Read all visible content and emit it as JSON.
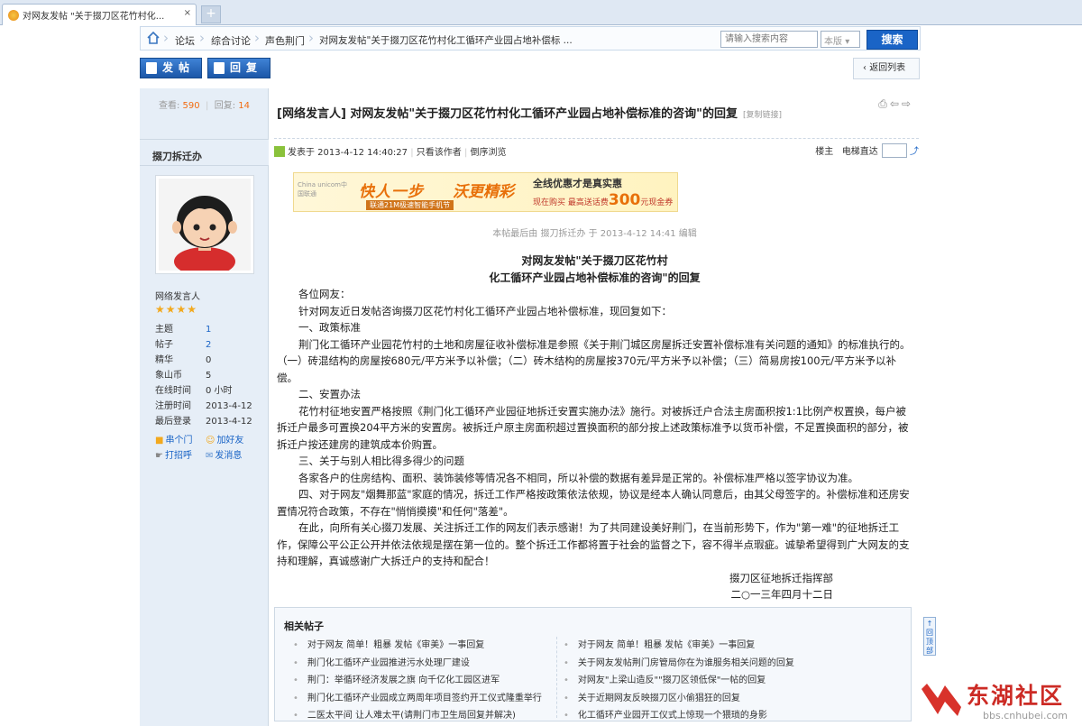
{
  "browser": {
    "tab_title": "对网友发帖 \"关于掇刀区花竹村化...",
    "close": "×",
    "new_tab": "+"
  },
  "breadcrumb": {
    "items": [
      "论坛",
      "综合讨论",
      "声色荆门",
      "对网友发帖\"关于掇刀区花竹村化工循环产业园占地补偿标 ..."
    ],
    "search_placeholder": "请输入搜索内容",
    "scope": "本版",
    "search_button": "搜索"
  },
  "toolbar": {
    "post_button": "发帖",
    "reply_button": "回复",
    "back_button": "返回列表"
  },
  "stats": {
    "views_label": "查看:",
    "views": "590",
    "replies_label": "回复:",
    "replies": "14"
  },
  "author": {
    "name": "掇刀拆迁办",
    "group": "网络发言人",
    "stars": "★★★★",
    "info": [
      {
        "k": "主题",
        "v": "1",
        "link": true
      },
      {
        "k": "帖子",
        "v": "2",
        "link": true
      },
      {
        "k": "精华",
        "v": "0",
        "link": false
      },
      {
        "k": "象山币",
        "v": "5",
        "link": false
      },
      {
        "k": "在线时间",
        "v": "0 小时",
        "link": false
      },
      {
        "k": "注册时间",
        "v": "2013-4-12",
        "link": false
      },
      {
        "k": "最后登录",
        "v": "2013-4-12",
        "link": false
      }
    ],
    "actions": [
      "串个门",
      "加好友",
      "打招呼",
      "发消息"
    ]
  },
  "post": {
    "title": "[网络发言人] 对网友发帖\"关于掇刀区花竹村化工循环产业园占地补偿标准的咨询\"的回复",
    "copy_link": "[复制链接]",
    "meta_time": "发表于 2013-4-12 14:40:27",
    "only_author": "只看该作者",
    "reverse": "倒序浏览",
    "floor": "楼主",
    "jump": "电梯直达",
    "edited": "本帖最后由 掇刀拆迁办 于 2013-4-12 14:41 编辑",
    "ad": {
      "logo": "China unicom中国联通",
      "slogan1": "快人一步",
      "slogan2": "沃更精彩",
      "promo": "全线优惠才是真实惠",
      "price_prefix": "现在购买 最高送话费",
      "price": "300",
      "price_suffix": "元现金券",
      "sub": "联通21M极速智能手机节"
    },
    "heading1": "对网友发帖\"关于掇刀区花竹村",
    "heading2": "化工循环产业园占地补偿标准的咨询\"的回复",
    "paragraphs": [
      "各位网友：",
      "针对网友近日发帖咨询掇刀区花竹村化工循环产业园占地补偿标准，现回复如下：",
      "一、政策标准",
      "荆门化工循环产业园花竹村的土地和房屋征收补偿标准是参照《关于荆门城区房屋拆迁安置补偿标准有关问题的通知》的标准执行的。（一）砖混结构的房屋按680元/平方米予以补偿；（二）砖木结构的房屋按370元/平方米予以补偿；（三）简易房按100元/平方米予以补偿。",
      "二、安置办法",
      "花竹村征地安置严格按照《荆门化工循环产业园征地拆迁安置实施办法》施行。对被拆迁户合法主房面积按1:1比例产权置换，每户被拆迁户最多可置换204平方米的安置房。被拆迁户原主房面积超过置换面积的部分按上述政策标准予以货币补偿，不足置换面积的部分，被拆迁户按还建房的建筑成本价购置。",
      "三、关于与别人相比得多得少的问题",
      "各家各户的住房结构、面积、装饰装修等情况各不相同，所以补偿的数据有差异是正常的。补偿标准严格以签字协议为准。",
      "四、对于网友\"烟舞那蓝\"家庭的情况，拆迁工作严格按政策依法依规，协议是经本人确认同意后，由其父母签字的。补偿标准和还房安置情况符合政策，不存在\"悄悄摸摸\"和任何\"落差\"。",
      "在此，向所有关心掇刀发展、关注拆迁工作的网友们表示感谢！为了共同建设美好荆门，在当前形势下，作为\"第一难\"的征地拆迁工作，保障公平公正公开并依法依规是摆在第一位的。整个拆迁工作都将置于社会的监督之下，容不得半点瑕疵。诚挚希望得到广大网友的支持和理解，真诚感谢广大拆迁户的支持和配合！"
    ],
    "signature": "掇刀区征地拆迁指挥部",
    "date": "二○一三年四月十二日"
  },
  "related": {
    "title": "相关帖子",
    "left": [
      "对于网友 简单！粗暴 发帖《审美》一事回复",
      "荆门化工循环产业园推进污水处理厂建设",
      "荆门：举循环经济发展之旗 向千亿化工园区进军",
      "荆门化工循环产业园成立两周年项目签约开工仪式隆重举行",
      "二医太平间 让人难太平(请荆门市卫生局回复并解决)"
    ],
    "right": [
      "对于网友 简单！粗暴 发帖《审美》一事回复",
      "关于网友发帖荆门房管局你在为谁服务相关问题的回复",
      "对网友\"上梁山造反\"\"掇刀区领低保\"一帖的回复",
      "关于近期网友反映掇刀区小偷猖狂的回复",
      "化工循环产业园开工仪式上惊现一个猥琐的身影"
    ]
  },
  "totop": "回顶部",
  "brand": {
    "name": "东湖社区",
    "url": "bbs.cnhubei.com"
  }
}
